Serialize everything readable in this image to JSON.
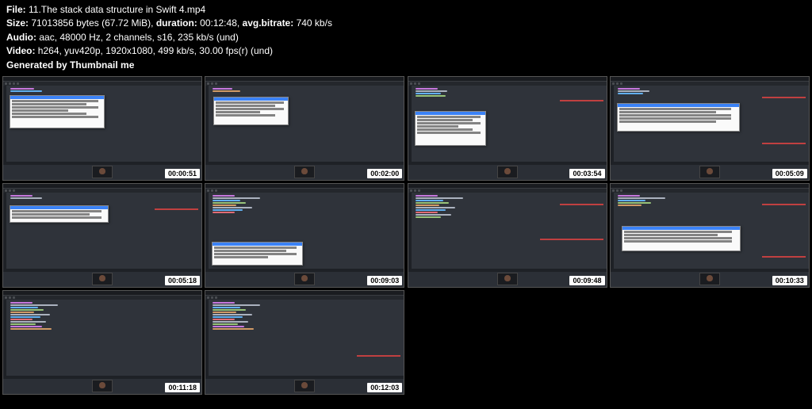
{
  "header": {
    "file_label": "File:",
    "file_value": "11.The stack data structure in Swift 4.mp4",
    "size_label": "Size:",
    "size_value": "71013856 bytes (67.72 MiB),",
    "duration_label": "duration:",
    "duration_value": "00:12:48,",
    "bitrate_label": "avg.bitrate:",
    "bitrate_value": "740 kb/s",
    "audio_label": "Audio:",
    "audio_value": "aac, 48000 Hz, 2 channels, s16, 235 kb/s (und)",
    "video_label": "Video:",
    "video_value": "h264, yuv420p, 1920x1080, 499 kb/s, 30.00 fps(r) (und)",
    "generated": "Generated by Thumbnail me"
  },
  "thumbnails": [
    {
      "timestamp": "00:00:51"
    },
    {
      "timestamp": "00:02:00"
    },
    {
      "timestamp": "00:03:54"
    },
    {
      "timestamp": "00:05:09"
    },
    {
      "timestamp": "00:05:18"
    },
    {
      "timestamp": "00:09:03"
    },
    {
      "timestamp": "00:09:48"
    },
    {
      "timestamp": "00:10:33"
    },
    {
      "timestamp": "00:11:18"
    },
    {
      "timestamp": "00:12:03"
    }
  ]
}
